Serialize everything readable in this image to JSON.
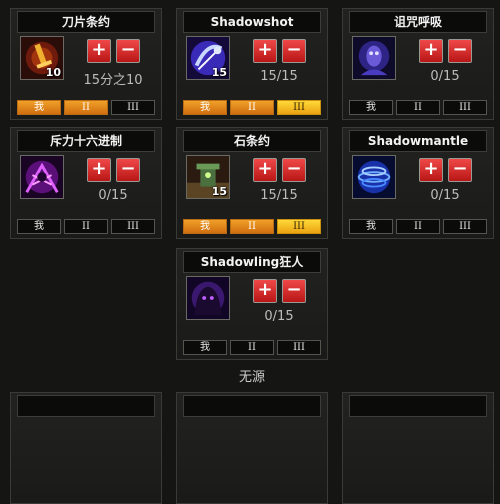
{
  "panels": [
    {
      "name": "刀片条约",
      "rank": "10",
      "points": "15分之10",
      "tiers": [
        "我",
        "II",
        "III"
      ],
      "tier_state": [
        "fill",
        "fill",
        "empty"
      ]
    },
    {
      "name": "Shadowshot",
      "rank": "15",
      "points": "15/15",
      "tiers": [
        "我",
        "II",
        "III"
      ],
      "tier_state": [
        "fill",
        "fill",
        "gold"
      ]
    },
    {
      "name": "诅咒呼吸",
      "rank": "",
      "points": "0/15",
      "tiers": [
        "我",
        "II",
        "III"
      ],
      "tier_state": [
        "empty",
        "empty",
        "empty"
      ]
    },
    {
      "name": "斥力十六进制",
      "rank": "",
      "points": "0/15",
      "tiers": [
        "我",
        "II",
        "III"
      ],
      "tier_state": [
        "empty",
        "empty",
        "empty"
      ]
    },
    {
      "name": "石条约",
      "rank": "15",
      "points": "15/15",
      "tiers": [
        "我",
        "II",
        "III"
      ],
      "tier_state": [
        "fill",
        "fill",
        "gold"
      ]
    },
    {
      "name": "Shadowmantle",
      "rank": "",
      "points": "0/15",
      "tiers": [
        "我",
        "II",
        "III"
      ],
      "tier_state": [
        "empty",
        "empty",
        "empty"
      ]
    },
    {
      "name": "Shadowling狂人",
      "rank": "",
      "points": "0/15",
      "tiers": [
        "我",
        "II",
        "III"
      ],
      "tier_state": [
        "empty",
        "empty",
        "empty"
      ]
    }
  ],
  "buttons": {
    "plus": "+",
    "minus": "−"
  },
  "footer": {
    "source": "无源"
  },
  "colors": {
    "fill": "#e08a1c",
    "gold": "#f8c828",
    "button": "#d42020",
    "background": "#151513"
  }
}
